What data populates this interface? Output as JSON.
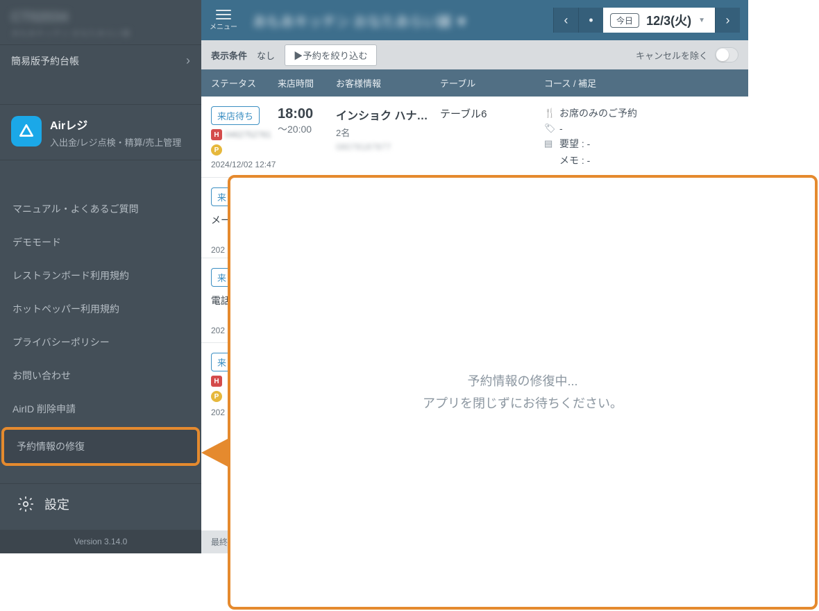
{
  "sidebar": {
    "store_code": "CT02034",
    "store_sub": "あもあキッチン おなたあらい舗",
    "row1": "簡易版予約台帳",
    "app": {
      "title": "Airレジ",
      "desc": "入出金/レジ点検・精算/売上管理"
    },
    "items": [
      "マニュアル・よくあるご質問",
      "デモモード",
      "レストランボード利用規約",
      "ホットペッパー利用規約",
      "プライバシーポリシー",
      "お問い合わせ",
      "AirID 削除申請",
      "予約情報の修復"
    ],
    "settings": "設定",
    "version": "Version 3.14.0"
  },
  "topbar": {
    "menu_label": "メニュー",
    "title_blur": "あもあキッチン おなたあらい舗 ▼",
    "today": "今日",
    "date": "12/3(火)"
  },
  "filter": {
    "label": "表示条件",
    "none": "なし",
    "narrow": "▶予約を絞り込む",
    "cancel": "キャンセルを除く"
  },
  "columns": {
    "status": "ステータス",
    "time": "来店時間",
    "guest": "お客様情報",
    "table": "テーブル",
    "course": "コース / 補足"
  },
  "reservation1": {
    "status": "来店待ち",
    "code": "0462752781",
    "timestamp": "2024/12/02 12:47",
    "time_start": "18:00",
    "time_end": "～20:00",
    "guest_name": "インショク ハナ…",
    "guest_count": "2名",
    "phone": "08078187877",
    "table": "テーブル6",
    "course1": "お席のみのご予約",
    "course2": "-",
    "course3": "要望 : -",
    "course4": "メモ : -"
  },
  "partial": {
    "p2_status": "来",
    "p2_text": "メー",
    "p2_ts": "202",
    "p3_status": "来",
    "p3_text": "電話",
    "p3_ts": "202",
    "p4_status": "来",
    "p4_ts": "202"
  },
  "footer": "最終更",
  "modal": {
    "line1": "予約情報の修復中...",
    "line2": "アプリを閉じずにお待ちください。"
  }
}
